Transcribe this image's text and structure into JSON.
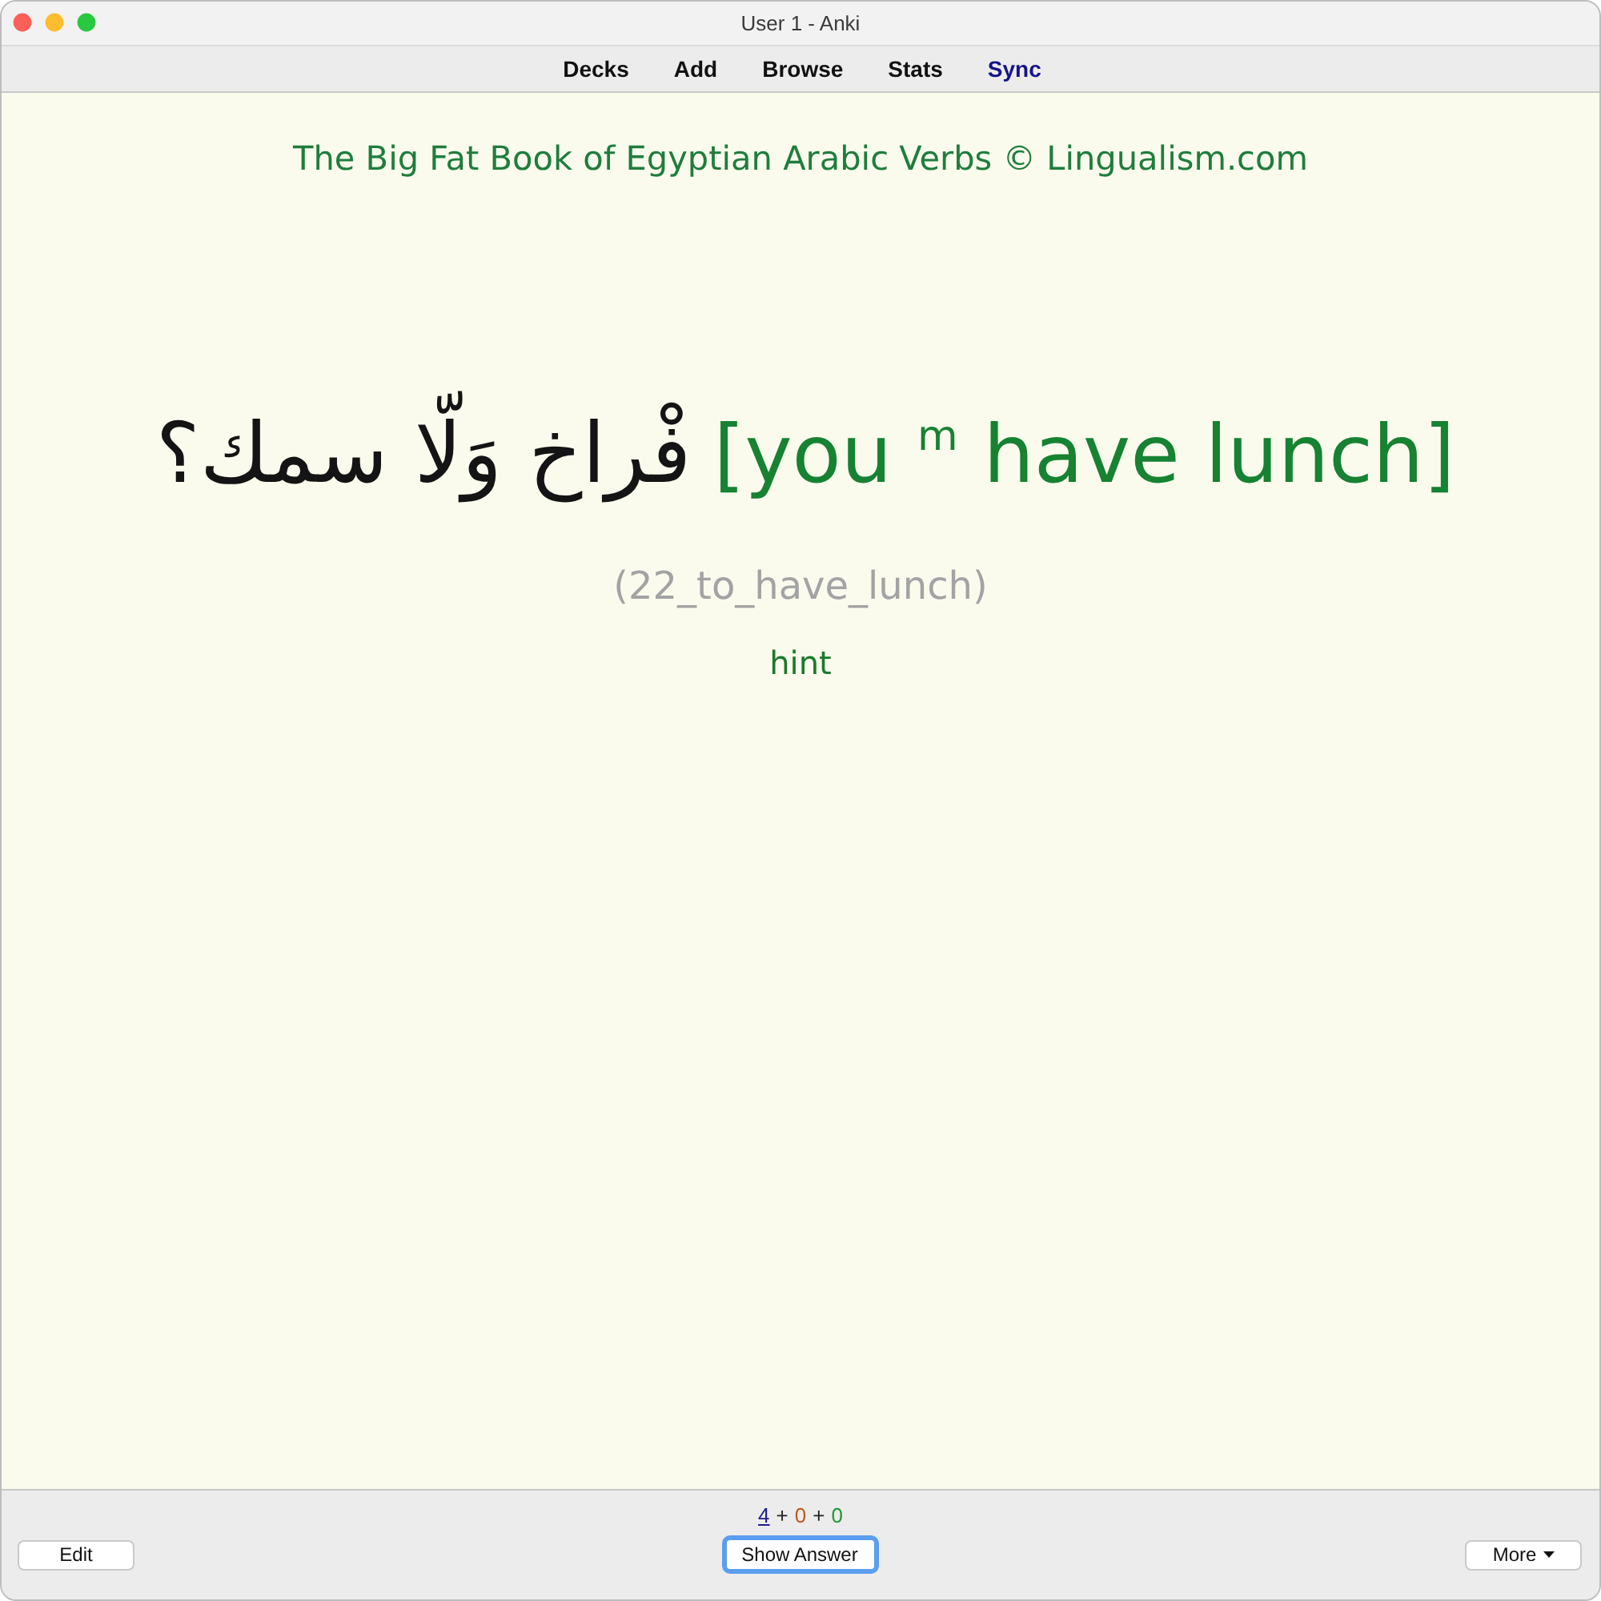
{
  "window": {
    "title": "User 1 - Anki"
  },
  "menu": [
    {
      "label": "Decks",
      "highlighted": false
    },
    {
      "label": "Add",
      "highlighted": false
    },
    {
      "label": "Browse",
      "highlighted": false
    },
    {
      "label": "Stats",
      "highlighted": false
    },
    {
      "label": "Sync",
      "highlighted": true
    }
  ],
  "card": {
    "deck_credit": "The Big Fat Book of Egyptian Arabic Verbs © Lingualism.com",
    "arabic": "فْراخ وَلّا سمك؟",
    "english": "[you $^{m}$ have lunch]",
    "note_id": "(22_to_have_lunch)",
    "hint": "hint"
  },
  "bottom_bar": {
    "edit_button": "Edit",
    "counts": [
      {
        "value": "4",
        "color": "#1c1c8e",
        "current": true
      },
      {
        "value": "0",
        "color": "#c0581a",
        "current": false
      },
      {
        "value": "0",
        "color": "#1f9a2c",
        "current": false
      }
    ],
    "separators": [
      "+",
      "+"
    ],
    "show_answer_button": {
      "label": "Show Answer",
      "focused": true
    },
    "more_button": "More"
  }
}
